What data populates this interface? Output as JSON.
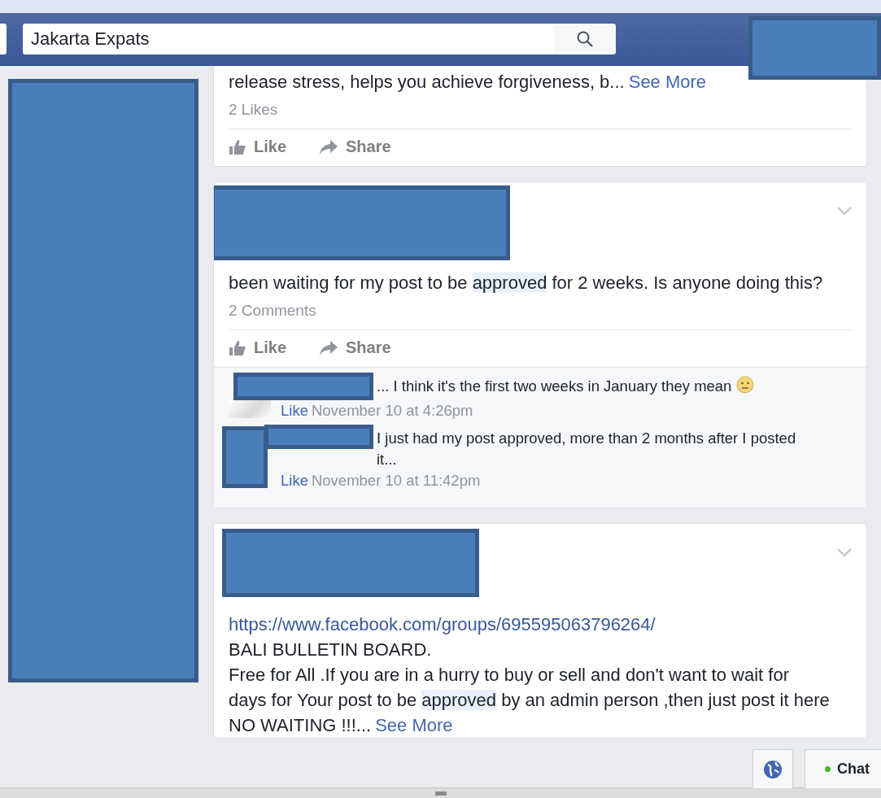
{
  "header": {
    "search": {
      "value": "Jakarta Expats"
    }
  },
  "posts": [
    {
      "paragraphs": [
        [
          {
            "text": "release stress, helps you achieve forgiveness, b...",
            "highlight": false
          }
        ]
      ],
      "see_more": "See More",
      "count": "2 Likes",
      "actions": [
        "Like",
        "Share"
      ],
      "menu": false
    },
    {
      "paragraphs": [
        [
          {
            "text": "been waiting for my post to be ",
            "highlight": false
          },
          {
            "text": "approved",
            "highlight": true
          },
          {
            "text": " for 2 weeks. Is anyone doing this?",
            "highlight": false
          }
        ]
      ],
      "count": "2 Comments",
      "actions": [
        "Like",
        "Share"
      ],
      "menu": true,
      "comments": [
        {
          "text": "... I think it's the first two weeks in January they mean",
          "emoji": true,
          "like": "Like",
          "time": "November 10 at 4:26pm"
        },
        {
          "text": "I just had my post approved, more than 2 months after I posted it...",
          "emoji": false,
          "like": "Like",
          "time": "November 10 at 11:42pm"
        }
      ]
    },
    {
      "link": "https://www.facebook.com/groups/695595063796264/",
      "paragraphs": [
        [
          {
            "text": "BALI BULLETIN BOARD.",
            "highlight": false
          }
        ],
        [
          {
            "text": "Free for All .If you are in a hurry to buy or sell and don't want to wait for days for Your post to be ",
            "highlight": false
          },
          {
            "text": "approved",
            "highlight": true
          },
          {
            "text": " by an admin person ,then just post it here",
            "highlight": false
          }
        ],
        [
          {
            "text": "NO WAITING !!!...",
            "highlight": false
          }
        ]
      ],
      "see_more": "See More",
      "menu": true
    }
  ],
  "chat": {
    "label": "Chat",
    "online": true
  }
}
